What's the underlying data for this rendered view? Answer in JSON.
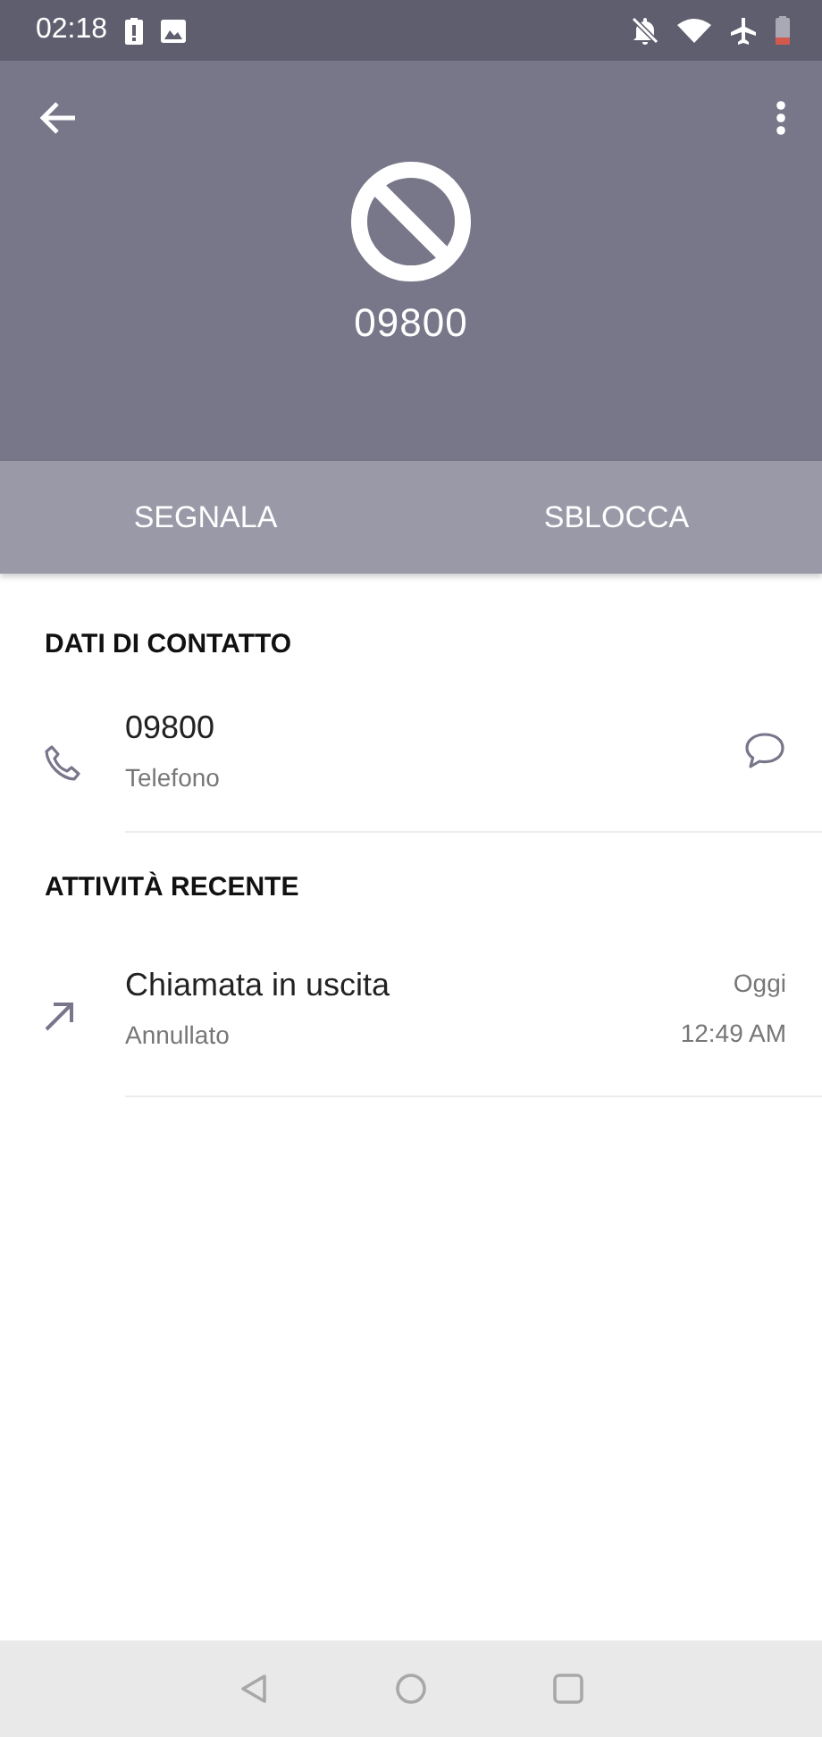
{
  "status_bar": {
    "time": "02:18"
  },
  "header": {
    "number": "09800"
  },
  "actions": [
    {
      "label": "SEGNALA"
    },
    {
      "label": "SBLOCCA"
    }
  ],
  "sections": [
    {
      "title": "DATI DI CONTATTO",
      "items": [
        {
          "kind": "contact",
          "primary": "09800",
          "secondary": "Telefono"
        }
      ]
    },
    {
      "title": "ATTIVITÀ RECENTE",
      "items": [
        {
          "kind": "call",
          "primary": "Chiamata in uscita",
          "secondary": "Annullato",
          "date": "Oggi",
          "time": "12:49 AM"
        }
      ]
    }
  ]
}
